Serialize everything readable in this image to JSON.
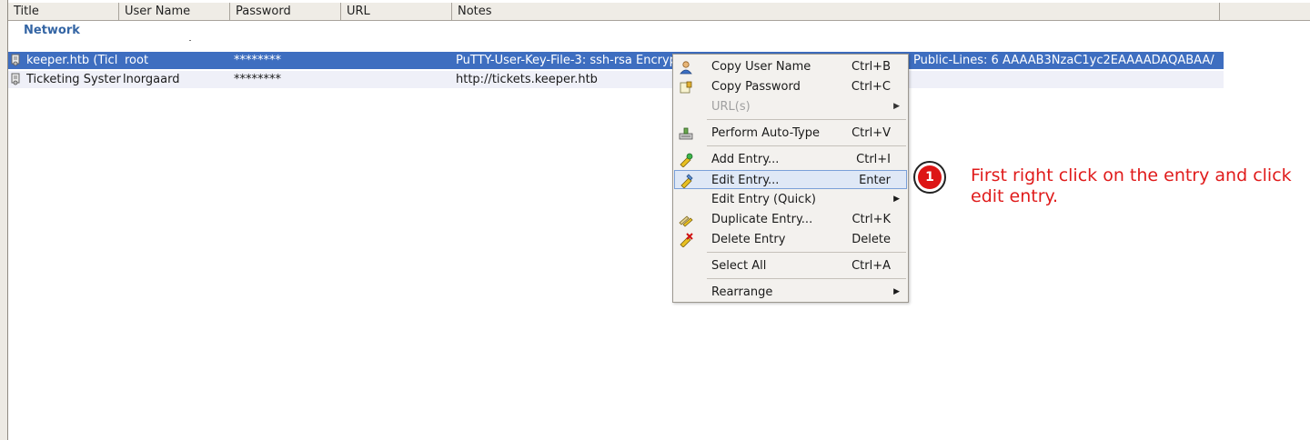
{
  "columns": [
    "Title",
    "User Name",
    "Password",
    "URL",
    "Notes"
  ],
  "group_label": "Network",
  "entries": [
    {
      "title": "keeper.htb (Ticl",
      "username": "root",
      "password": "********",
      "notes": "PuTTY-User-Key-File-3: ssh-rsa Encryp"
    },
    {
      "title": "Ticketing Syster",
      "username": "lnorgaard",
      "password": "********",
      "notes": "http://tickets.keeper.htb"
    }
  ],
  "selected_row_tail": "Public-Lines: 6 AAAAB3NzaC1yc2EAAAADAQABAA/",
  "context_menu": {
    "items": [
      {
        "label": "Copy User Name",
        "shortcut": "Ctrl+B",
        "icon": "user-icon"
      },
      {
        "label": "Copy Password",
        "shortcut": "Ctrl+C",
        "icon": "key-icon"
      },
      {
        "label": "URL(s)",
        "shortcut": "",
        "icon": "",
        "submenu": true,
        "disabled": true
      },
      {
        "label": "Perform Auto-Type",
        "shortcut": "Ctrl+V",
        "icon": "auto-type-icon"
      },
      {
        "label": "Add Entry...",
        "shortcut": "Ctrl+I",
        "icon": "add-entry-icon"
      },
      {
        "label": "Edit Entry...",
        "shortcut": "Enter",
        "icon": "edit-entry-icon",
        "highlighted": true
      },
      {
        "label": "Edit Entry (Quick)",
        "shortcut": "",
        "icon": "",
        "submenu": true
      },
      {
        "label": "Duplicate Entry...",
        "shortcut": "Ctrl+K",
        "icon": "duplicate-entry-icon"
      },
      {
        "label": "Delete Entry",
        "shortcut": "Delete",
        "icon": "delete-entry-icon"
      },
      {
        "label": "Select All",
        "shortcut": "Ctrl+A",
        "icon": ""
      },
      {
        "label": "Rearrange",
        "shortcut": "",
        "icon": "",
        "submenu": true
      }
    ]
  },
  "annotation": {
    "step": "1",
    "text": "First right click on the entry and click edit entry."
  },
  "colors": {
    "selection": "#3e6ec0",
    "group_label": "#3465a4",
    "annotation": "#e01b1b",
    "menu_highlight": "#dfe8f6"
  }
}
